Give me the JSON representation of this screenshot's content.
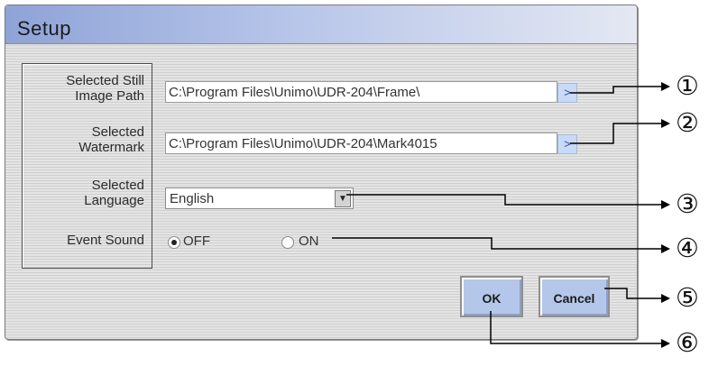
{
  "dialog": {
    "title": "Setup",
    "labels": {
      "still_image_path_line1": "Selected Still",
      "still_image_path_line2": "Image Path",
      "watermark_line1": "Selected",
      "watermark_line2": "Watermark",
      "language_line1": "Selected",
      "language_line2": "Language",
      "event_sound": "Event Sound"
    },
    "still_image_path": "C:\\Program Files\\Unimo\\UDR-204\\Frame\\",
    "watermark_path": "C:\\Program Files\\Unimo\\UDR-204\\Mark4015",
    "browse_glyph": ">",
    "language": {
      "selected": "English"
    },
    "event_sound": {
      "off_label": "OFF",
      "on_label": "ON",
      "selected": "OFF"
    },
    "buttons": {
      "ok": "OK",
      "cancel": "Cancel"
    }
  },
  "callouts": [
    "①",
    "②",
    "③",
    "④",
    "⑤",
    "⑥"
  ]
}
